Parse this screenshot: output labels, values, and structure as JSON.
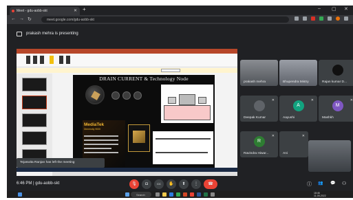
{
  "browser": {
    "tab_title": "Meet - gdu-aobb-skt",
    "tab_close": "✕",
    "new_tab": "+",
    "url": "meet.google.com/gdu-aobb-skt",
    "minimize": "–",
    "maximize": "▢",
    "close": "✕"
  },
  "banner": {
    "text": "prakash mehra is presenting"
  },
  "presentation": {
    "slide_title": "DRAIN CURRENT & Technology Node",
    "brand": "MediaTek",
    "brand_tag": "Dimensity 9000"
  },
  "toast": {
    "text": "Tejaswita Ranjan has left the meeting"
  },
  "participants": [
    {
      "name": "prakash mehra",
      "type": "photo",
      "color": "#6b6f74"
    },
    {
      "name": "Bhupendra Mistry",
      "type": "photo",
      "color": "#7a7f88"
    },
    {
      "name": "Rajan kumar D...",
      "type": "avatar",
      "letter": "",
      "color": "#111111"
    },
    {
      "name": "Deepak Kumar",
      "type": "avatar",
      "letter": "",
      "color": "#3c4043"
    },
    {
      "name": "Aayushi",
      "type": "avatar",
      "letter": "A",
      "color": "#12a37f"
    },
    {
      "name": "Mashkh",
      "type": "avatar",
      "letter": "M",
      "color": "#7e57c2"
    },
    {
      "name": "Ravindra Hiwar...",
      "type": "avatar",
      "letter": "R",
      "color": "#2e7d32"
    },
    {
      "name": "Ani",
      "type": "photo",
      "color": "#555a60"
    },
    {
      "name": "",
      "type": "self",
      "color": "#4a4f55"
    }
  ],
  "meeting": {
    "time": "6:46 PM",
    "separator": "|",
    "code": "gdu-aobb-skt"
  },
  "controls": {
    "mic": "🎙",
    "camera": "◘",
    "captions": "CC",
    "hand": "✋",
    "present": "⬆",
    "more": "⋮",
    "end_call": "☎"
  },
  "right_controls": {
    "info": "ⓘ",
    "people": "👥",
    "chat": "💬",
    "activities": "⚇"
  },
  "taskbar": {
    "search": "Search",
    "time": "18:46",
    "date": "11-05-2022"
  }
}
